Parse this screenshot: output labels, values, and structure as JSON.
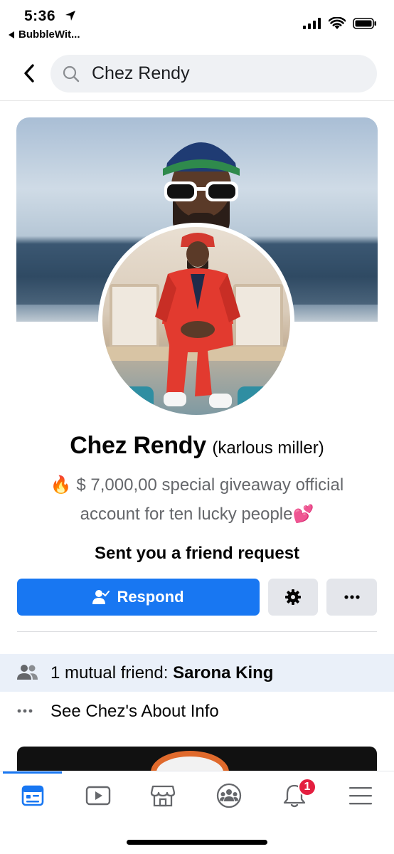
{
  "status_bar": {
    "time": "5:36",
    "back_app": "BubbleWit..."
  },
  "search": {
    "query": "Chez Rendy"
  },
  "profile": {
    "name": "Chez Rendy",
    "alt_name": "(karlous miller)",
    "bio_line1": "$ 7,000,00 special giveaway official",
    "bio_line2": "account for ten lucky people",
    "bio_emoji_start": "🔥",
    "bio_emoji_end": "💕",
    "friend_request_text": "Sent you a friend request"
  },
  "actions": {
    "respond_label": "Respond"
  },
  "info": {
    "mutual_prefix": "1 mutual friend: ",
    "mutual_name": "Sarona King",
    "about_label": "See Chez's About Info"
  },
  "tabs": {
    "notifications_badge": "1",
    "items": [
      "home-feed",
      "watch",
      "marketplace",
      "groups",
      "notifications",
      "menu"
    ]
  },
  "colors": {
    "accent": "#1877f2",
    "badge": "#e41e3f",
    "mutual_bg": "#eaf0f9"
  }
}
